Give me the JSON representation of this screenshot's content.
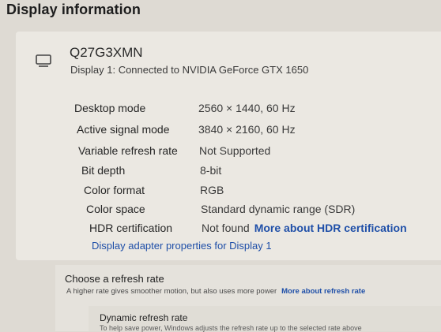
{
  "page_title": "Display information",
  "monitor": {
    "name": "Q27G3XMN",
    "connection": "Display 1: Connected to NVIDIA GeForce GTX 1650",
    "icon": "monitor-icon"
  },
  "specs": [
    {
      "label": "Desktop mode",
      "value": "2560 × 1440, 60 Hz"
    },
    {
      "label": "Active signal mode",
      "value": "3840 × 2160, 60 Hz"
    },
    {
      "label": "Variable refresh rate",
      "value": "Not Supported"
    },
    {
      "label": "Bit depth",
      "value": "8-bit"
    },
    {
      "label": "Color format",
      "value": "RGB"
    },
    {
      "label": "Color space",
      "value": "Standard dynamic range (SDR)"
    },
    {
      "label": "HDR certification",
      "value": "Not found",
      "link": "More about HDR certification"
    }
  ],
  "adapter_link": "Display adapter properties for Display 1",
  "refresh": {
    "title": "Choose a refresh rate",
    "description": "A higher rate gives smoother motion, but also uses more power",
    "link": "More about refresh rate"
  },
  "dynamic": {
    "title": "Dynamic refresh rate",
    "description": "To help save power, Windows adjusts the refresh rate up to the selected rate above"
  },
  "colors": {
    "link": "#1f4fa8",
    "background": "#dedad3",
    "panel": "#ebe8e2"
  }
}
